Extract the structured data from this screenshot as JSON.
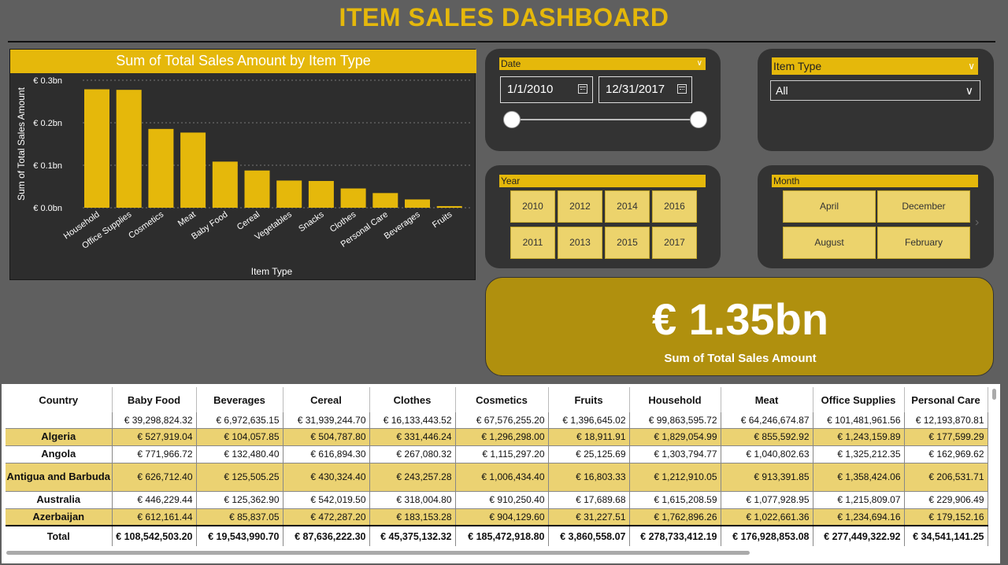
{
  "title": "ITEM SALES DASHBOARD",
  "chart_data": {
    "type": "bar",
    "title": "Sum of Total Sales Amount by Item Type",
    "xlabel": "Item Type",
    "ylabel": "Sum of Total Sales Amount",
    "categories": [
      "Household",
      "Office Supplies",
      "Cosmetics",
      "Meat",
      "Baby Food",
      "Cereal",
      "Vegetables",
      "Snacks",
      "Clothes",
      "Personal Care",
      "Beverages",
      "Fruits"
    ],
    "values": [
      0.278733412,
      0.277449323,
      0.185472919,
      0.176928853,
      0.108542503,
      0.087636222,
      0.064,
      0.063,
      0.045375132,
      0.034541141,
      0.019543991,
      0.003860558
    ],
    "yticks": [
      0,
      0.1,
      0.2,
      0.3
    ],
    "ytick_labels": [
      "€ 0.0bn",
      "€ 0.1bn",
      "€ 0.2bn",
      "€ 0.3bn"
    ],
    "ylim": [
      0,
      0.3
    ],
    "grid": true,
    "color": "#e5b80b"
  },
  "date_slicer": {
    "label": "Date",
    "start": "1/1/2010",
    "end": "12/31/2017"
  },
  "item_slicer": {
    "label": "Item Type",
    "value": "All"
  },
  "year_slicer": {
    "label": "Year",
    "years": [
      "2010",
      "2012",
      "2014",
      "2016",
      "2011",
      "2013",
      "2015",
      "2017"
    ]
  },
  "month_slicer": {
    "label": "Month",
    "months": [
      "April",
      "December",
      "August",
      "February"
    ]
  },
  "kpi": {
    "value": "€ 1.35bn",
    "label": "Sum of Total Sales Amount"
  },
  "table": {
    "columns": [
      "Country",
      "Baby Food",
      "Beverages",
      "Cereal",
      "Clothes",
      "Cosmetics",
      "Fruits",
      "Household",
      "Meat",
      "Office Supplies",
      "Personal Care"
    ],
    "rows": [
      [
        "",
        "€ 39,298,824.32",
        "€ 6,972,635.15",
        "€ 31,939,244.70",
        "€ 16,133,443.52",
        "€ 67,576,255.20",
        "€ 1,396,645.02",
        "€ 99,863,595.72",
        "€ 64,246,674.87",
        "€ 101,481,961.56",
        "€ 12,193,870.81"
      ],
      [
        "Algeria",
        "€ 527,919.04",
        "€ 104,057.85",
        "€ 504,787.80",
        "€ 331,446.24",
        "€ 1,296,298.00",
        "€ 18,911.91",
        "€ 1,829,054.99",
        "€ 855,592.92",
        "€ 1,243,159.89",
        "€ 177,599.29"
      ],
      [
        "Angola",
        "€ 771,966.72",
        "€ 132,480.40",
        "€ 616,894.30",
        "€ 267,080.32",
        "€ 1,115,297.20",
        "€ 25,125.69",
        "€ 1,303,794.77",
        "€ 1,040,802.63",
        "€ 1,325,212.35",
        "€ 162,969.62"
      ],
      [
        "Antigua and Barbuda",
        "€ 626,712.40",
        "€ 125,505.25",
        "€ 430,324.40",
        "€ 243,257.28",
        "€ 1,006,434.40",
        "€ 16,803.33",
        "€ 1,212,910.05",
        "€ 913,391.85",
        "€ 1,358,424.06",
        "€ 206,531.71"
      ],
      [
        "Australia",
        "€ 446,229.44",
        "€ 125,362.90",
        "€ 542,019.50",
        "€ 318,004.80",
        "€ 910,250.40",
        "€ 17,689.68",
        "€ 1,615,208.59",
        "€ 1,077,928.95",
        "€ 1,215,809.07",
        "€ 229,906.49"
      ],
      [
        "Azerbaijan",
        "€ 612,161.44",
        "€ 85,837.05",
        "€ 472,287.20",
        "€ 183,153.28",
        "€ 904,129.60",
        "€ 31,227.51",
        "€ 1,762,896.26",
        "€ 1,022,661.36",
        "€ 1,234,694.16",
        "€ 179,152.16"
      ]
    ],
    "total": [
      "Total",
      "€ 108,542,503.20",
      "€ 19,543,990.70",
      "€ 87,636,222.30",
      "€ 45,375,132.32",
      "€ 185,472,918.80",
      "€ 3,860,558.07",
      "€ 278,733,412.19",
      "€ 176,928,853.08",
      "€ 277,449,322.92",
      "€ 34,541,141.25"
    ]
  }
}
